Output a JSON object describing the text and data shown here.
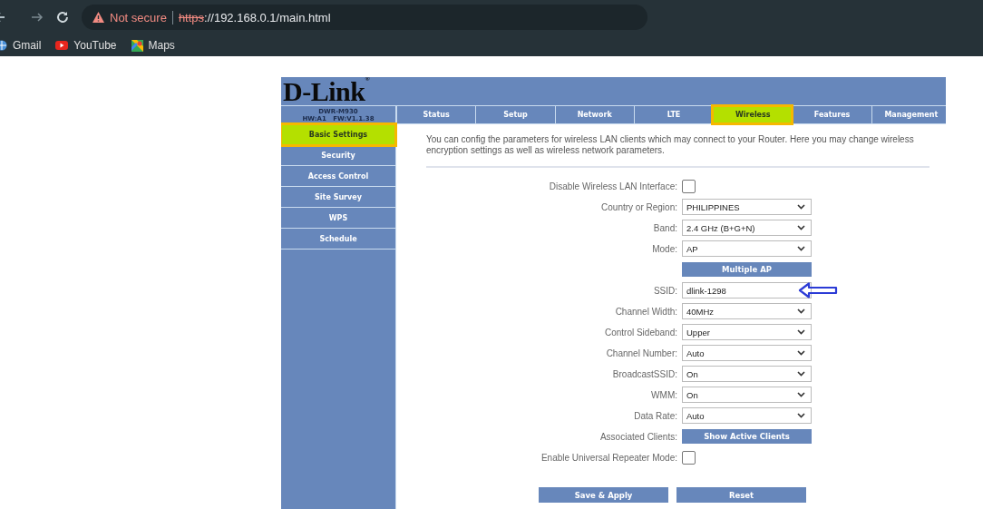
{
  "browser": {
    "security": "Not secure",
    "scheme": "https",
    "address": "://192.168.0.1/main.html",
    "bookmarks": [
      {
        "label": "Gmail"
      },
      {
        "label": "YouTube"
      },
      {
        "label": "Maps"
      }
    ]
  },
  "router": {
    "logo": "D-Link$^{®}$",
    "model": "DWR-M930",
    "firmware": "HW:A1   FW:V1.1.38",
    "tabs": [
      {
        "label": "Status",
        "selected": false
      },
      {
        "label": "Setup",
        "selected": false
      },
      {
        "label": "Network",
        "selected": false
      },
      {
        "label": "LTE",
        "selected": false
      },
      {
        "label": "Wireless",
        "selected": true
      },
      {
        "label": "Features",
        "selected": false
      },
      {
        "label": "Management",
        "selected": false
      }
    ],
    "sidebar": [
      {
        "label": "Basic Settings",
        "selected": true
      },
      {
        "label": "Security",
        "selected": false
      },
      {
        "label": "Access Control",
        "selected": false
      },
      {
        "label": "Site Survey",
        "selected": false
      },
      {
        "label": "WPS",
        "selected": false
      },
      {
        "label": "Schedule",
        "selected": false
      }
    ],
    "intro": "You can config the parameters for wireless LAN clients which may connect to your Router. Here you may change wireless encryption settings as well as wireless network parameters.",
    "form": [
      {
        "kind": "checkbox",
        "label": "Disable Wireless LAN Interface:",
        "checked": false
      },
      {
        "kind": "select",
        "label": "Country or Region:",
        "value": "PHILIPPINES"
      },
      {
        "kind": "select",
        "label": "Band:",
        "value": "2.4 GHz (B+G+N)"
      },
      {
        "kind": "select",
        "label": "Mode:",
        "value": "AP"
      },
      {
        "kind": "button",
        "value": "Multiple AP"
      },
      {
        "kind": "text",
        "label": "SSID:",
        "value": "dlink-1298",
        "pointed": true
      },
      {
        "kind": "select",
        "label": "Channel Width:",
        "value": "40MHz"
      },
      {
        "kind": "select",
        "label": "Control Sideband:",
        "value": "Upper"
      },
      {
        "kind": "select",
        "label": "Channel Number:",
        "value": "Auto"
      },
      {
        "kind": "select",
        "label": "BroadcastSSID:",
        "value": "On"
      },
      {
        "kind": "select",
        "label": "WMM:",
        "value": "On"
      },
      {
        "kind": "select",
        "label": "Data Rate:",
        "value": "Auto"
      },
      {
        "kind": "button",
        "label": "Associated Clients:",
        "value": "Show Active Clients"
      },
      {
        "kind": "checkbox",
        "label": "Enable Universal Repeater Mode:",
        "checked": false
      }
    ],
    "actions": [
      "Save & Apply",
      "Reset"
    ]
  }
}
